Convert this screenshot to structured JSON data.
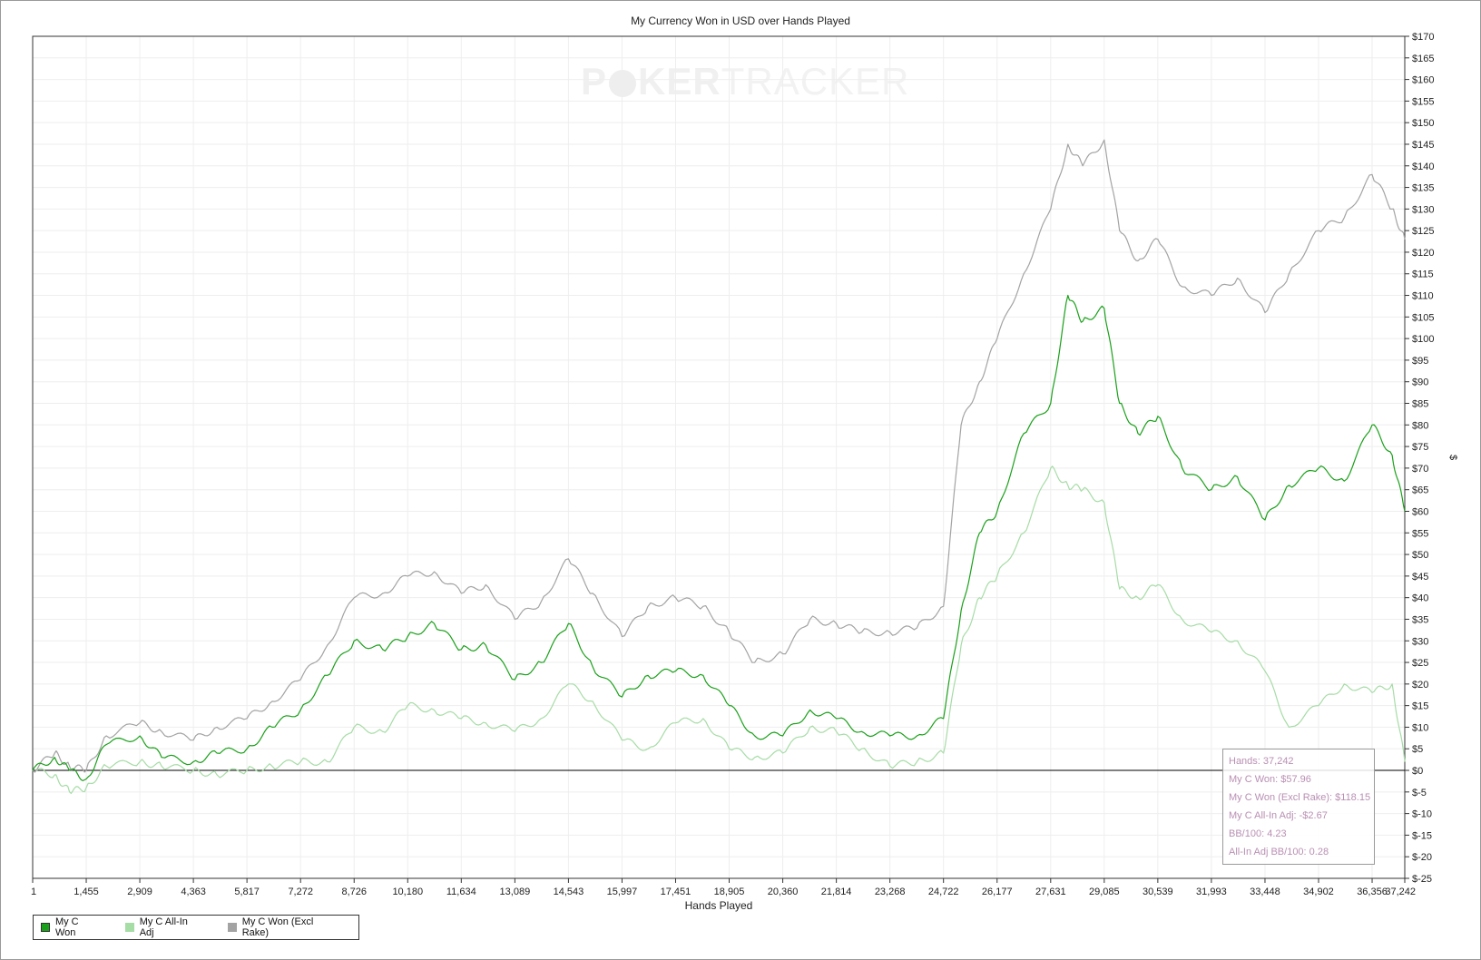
{
  "chart_data": {
    "type": "line",
    "title": "My Currency Won in USD over Hands Played",
    "xlabel": "Hands Played",
    "ylabel": "$",
    "x_ticks": [
      "1",
      "1,455",
      "2,909",
      "4,363",
      "5,817",
      "7,272",
      "8,726",
      "10,180",
      "11,634",
      "13,089",
      "14,543",
      "15,997",
      "17,451",
      "18,905",
      "20,360",
      "21,814",
      "23,268",
      "24,722",
      "26,177",
      "27,631",
      "29,085",
      "30,539",
      "31,993",
      "33,448",
      "34,902",
      "36,356",
      "37,242"
    ],
    "x_tick_values": [
      1,
      1455,
      2909,
      4363,
      5817,
      7272,
      8726,
      10180,
      11634,
      13089,
      14543,
      15997,
      17451,
      18905,
      20360,
      21814,
      23268,
      24722,
      26177,
      27631,
      29085,
      30539,
      31993,
      33448,
      34902,
      36356,
      37242
    ],
    "y_ticks": [
      "$170",
      "$165",
      "$160",
      "$155",
      "$150",
      "$145",
      "$140",
      "$135",
      "$130",
      "$125",
      "$120",
      "$115",
      "$110",
      "$105",
      "$100",
      "$95",
      "$90",
      "$85",
      "$80",
      "$75",
      "$70",
      "$65",
      "$60",
      "$55",
      "$50",
      "$45",
      "$40",
      "$35",
      "$30",
      "$25",
      "$20",
      "$15",
      "$10",
      "$5",
      "$0",
      "$-5",
      "$-10",
      "$-15",
      "$-20",
      "$-25"
    ],
    "xlim": [
      1,
      37242
    ],
    "ylim": [
      -25,
      170
    ],
    "grid": true,
    "legend_position": "bottom-left",
    "x": [
      1,
      600,
      1000,
      1455,
      2000,
      2909,
      3500,
      4363,
      5000,
      5817,
      6500,
      7272,
      8000,
      8726,
      9500,
      10180,
      10900,
      11634,
      12300,
      13089,
      13800,
      14543,
      15200,
      15997,
      16700,
      17451,
      18200,
      18905,
      19600,
      20360,
      21100,
      21814,
      22500,
      23268,
      24000,
      24722,
      25200,
      25700,
      26177,
      26900,
      27631,
      28100,
      28500,
      29085,
      29500,
      30000,
      30539,
      31200,
      31993,
      32700,
      33448,
      34100,
      34902,
      35600,
      36356,
      36900,
      37242
    ],
    "series": [
      {
        "name": "My C Won",
        "color": "#1aa01a",
        "values": [
          0,
          3,
          0,
          -2,
          6,
          8,
          3,
          2,
          4,
          5,
          10,
          14,
          22,
          30,
          28,
          31,
          34,
          28,
          29,
          21,
          25,
          34,
          24,
          17,
          22,
          23,
          22,
          15,
          8,
          8,
          14,
          12,
          9,
          8,
          8,
          12,
          37,
          55,
          60,
          78,
          85,
          110,
          104,
          107,
          85,
          78,
          82,
          70,
          65,
          68,
          58,
          66,
          70,
          67,
          80,
          73,
          60
        ]
      },
      {
        "name": "My C All-In Adj",
        "color": "#a6dca6",
        "values": [
          0,
          -1,
          -5,
          -4,
          1,
          2,
          1,
          0,
          -1,
          0,
          1,
          2,
          2,
          10,
          9,
          15,
          14,
          12,
          11,
          9,
          12,
          20,
          16,
          7,
          5,
          11,
          12,
          5,
          3,
          4,
          10,
          9,
          5,
          1,
          2,
          4,
          29,
          40,
          45,
          55,
          70,
          66,
          65,
          62,
          42,
          40,
          43,
          35,
          32,
          30,
          23,
          10,
          15,
          20,
          18,
          20,
          2
        ]
      },
      {
        "name": "My C Won (Excl Rake)",
        "color": "#a3a3a3",
        "values": [
          0,
          4,
          1,
          0,
          8,
          11,
          9,
          7,
          10,
          12,
          16,
          21,
          29,
          40,
          41,
          45,
          46,
          41,
          43,
          35,
          39,
          49,
          41,
          31,
          38,
          40,
          38,
          32,
          25,
          27,
          35,
          34,
          32,
          32,
          33,
          38,
          80,
          90,
          100,
          115,
          130,
          145,
          140,
          146,
          125,
          118,
          123,
          112,
          110,
          114,
          106,
          115,
          125,
          128,
          138,
          130,
          123
        ]
      }
    ]
  },
  "tooltip": {
    "hands": "Hands: 37,242",
    "won": "My C Won: $57.96",
    "won_excl_rake": "My C Won (Excl Rake): $118.15",
    "allin_adj": "My C All-In Adj: -$2.67",
    "bb100": "BB/100: 4.23",
    "allin_bb100": "All-In Adj BB/100: 0.28"
  },
  "watermark": {
    "logo_bold": "POKER",
    "logo_light": "TRACKER"
  }
}
